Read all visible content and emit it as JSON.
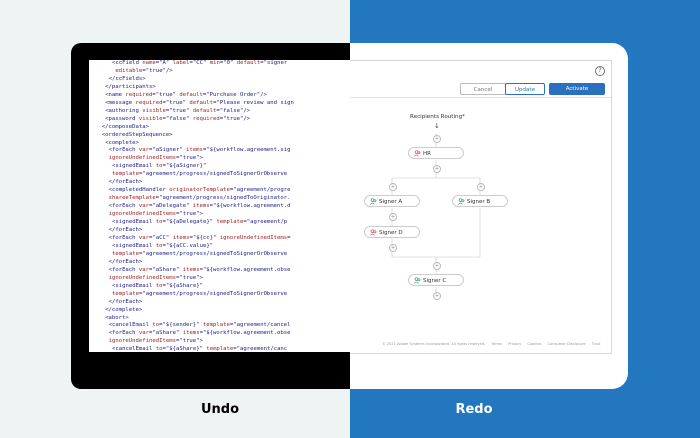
{
  "code_lines": [
    {
      "ind": 5,
      "toks": [
        [
          "t",
          "<ccField "
        ],
        [
          "a",
          "name"
        ],
        [
          "t",
          "="
        ],
        [
          "v",
          "\"A\""
        ],
        [
          "t",
          " "
        ],
        [
          "a",
          "label"
        ],
        [
          "t",
          "="
        ],
        [
          "v",
          "\"CC\""
        ],
        [
          "t",
          " "
        ],
        [
          "a",
          "min"
        ],
        [
          "t",
          "="
        ],
        [
          "v",
          "\"0\""
        ],
        [
          "t",
          " "
        ],
        [
          "a",
          "default"
        ],
        [
          "t",
          "="
        ],
        [
          "v",
          "\"signer"
        ]
      ]
    },
    {
      "ind": 6,
      "toks": [
        [
          "a",
          "editable"
        ],
        [
          "t",
          "="
        ],
        [
          "v",
          "\"true\""
        ],
        [
          "t",
          "/>"
        ]
      ]
    },
    {
      "ind": 4,
      "toks": [
        [
          "t",
          "</ccFields>"
        ]
      ]
    },
    {
      "ind": 3,
      "toks": [
        [
          "t",
          "</participants>"
        ]
      ]
    },
    {
      "ind": 3,
      "toks": [
        [
          "t",
          "<name "
        ],
        [
          "a",
          "required"
        ],
        [
          "t",
          "="
        ],
        [
          "v",
          "\"true\""
        ],
        [
          "t",
          " "
        ],
        [
          "a",
          "default"
        ],
        [
          "t",
          "="
        ],
        [
          "v",
          "\"Purchase Order\""
        ],
        [
          "t",
          "/>"
        ]
      ]
    },
    {
      "ind": 3,
      "toks": [
        [
          "t",
          "<message "
        ],
        [
          "a",
          "required"
        ],
        [
          "t",
          "="
        ],
        [
          "v",
          "\"true\""
        ],
        [
          "t",
          " "
        ],
        [
          "a",
          "default"
        ],
        [
          "t",
          "="
        ],
        [
          "v",
          "\"Please review and sign"
        ]
      ]
    },
    {
      "ind": 3,
      "toks": [
        [
          "t",
          "<authoring "
        ],
        [
          "a",
          "visible"
        ],
        [
          "t",
          "="
        ],
        [
          "v",
          "\"true\""
        ],
        [
          "t",
          " "
        ],
        [
          "a",
          "default"
        ],
        [
          "t",
          "="
        ],
        [
          "v",
          "\"false\""
        ],
        [
          "t",
          "/>"
        ]
      ]
    },
    {
      "ind": 3,
      "toks": [
        [
          "t",
          "<password "
        ],
        [
          "a",
          "visible"
        ],
        [
          "t",
          "="
        ],
        [
          "v",
          "\"false\""
        ],
        [
          "t",
          " "
        ],
        [
          "a",
          "required"
        ],
        [
          "t",
          "="
        ],
        [
          "v",
          "\"true\""
        ],
        [
          "t",
          "/>"
        ]
      ]
    },
    {
      "ind": 2,
      "toks": [
        [
          "t",
          "</composeData>"
        ]
      ]
    },
    {
      "ind": 2,
      "toks": [
        [
          "t",
          "<orderedStepSequence>"
        ]
      ]
    },
    {
      "ind": 3,
      "toks": [
        [
          "t",
          "<complete>"
        ]
      ]
    },
    {
      "ind": 4,
      "toks": [
        [
          "t",
          "<forEach "
        ],
        [
          "a",
          "var"
        ],
        [
          "t",
          "="
        ],
        [
          "v",
          "\"aSigner\""
        ],
        [
          "t",
          " "
        ],
        [
          "a",
          "items"
        ],
        [
          "t",
          "="
        ],
        [
          "v",
          "\"${workflow.agreement.sig"
        ]
      ]
    },
    {
      "ind": 4,
      "toks": [
        [
          "a",
          "ignoreUndefinedItems"
        ],
        [
          "t",
          "="
        ],
        [
          "v",
          "\"true\""
        ],
        [
          "t",
          ">"
        ]
      ]
    },
    {
      "ind": 5,
      "toks": [
        [
          "t",
          "<signedEmail "
        ],
        [
          "a",
          "to"
        ],
        [
          "t",
          "="
        ],
        [
          "v",
          "\"${aSigner}\""
        ]
      ]
    },
    {
      "ind": 5,
      "toks": [
        [
          "a",
          "template"
        ],
        [
          "t",
          "="
        ],
        [
          "v",
          "\"agreement/progress/signedToSignerOrObserve"
        ]
      ]
    },
    {
      "ind": 4,
      "toks": [
        [
          "t",
          "</forEach>"
        ]
      ]
    },
    {
      "ind": 4,
      "toks": [
        [
          "t",
          "<completedHandler "
        ],
        [
          "a",
          "originatorTemplate"
        ],
        [
          "t",
          "="
        ],
        [
          "v",
          "\"agreement/progre"
        ]
      ]
    },
    {
      "ind": 4,
      "toks": [
        [
          "a",
          "shareeTemplate"
        ],
        [
          "t",
          "="
        ],
        [
          "v",
          "\"agreement/progress/signedToOriginator."
        ]
      ]
    },
    {
      "ind": 4,
      "toks": [
        [
          "t",
          "<forEach "
        ],
        [
          "a",
          "var"
        ],
        [
          "t",
          "="
        ],
        [
          "v",
          "\"aDelegate\""
        ],
        [
          "t",
          " "
        ],
        [
          "a",
          "items"
        ],
        [
          "t",
          "="
        ],
        [
          "v",
          "\"${workflow.agreement.d"
        ]
      ]
    },
    {
      "ind": 4,
      "toks": [
        [
          "a",
          "ignoreUndefinedItems"
        ],
        [
          "t",
          "="
        ],
        [
          "v",
          "\"true\""
        ],
        [
          "t",
          ">"
        ]
      ]
    },
    {
      "ind": 5,
      "toks": [
        [
          "t",
          "<signedEmail "
        ],
        [
          "a",
          "to"
        ],
        [
          "t",
          "="
        ],
        [
          "v",
          "\"${aDelegate}\""
        ],
        [
          "t",
          " "
        ],
        [
          "a",
          "template"
        ],
        [
          "t",
          "="
        ],
        [
          "v",
          "\"agreement/p"
        ]
      ]
    },
    {
      "ind": 4,
      "toks": [
        [
          "t",
          "</forEach>"
        ]
      ]
    },
    {
      "ind": 4,
      "toks": [
        [
          "t",
          "<forEach "
        ],
        [
          "a",
          "var"
        ],
        [
          "t",
          "="
        ],
        [
          "v",
          "\"aCC\""
        ],
        [
          "t",
          " "
        ],
        [
          "a",
          "items"
        ],
        [
          "t",
          "="
        ],
        [
          "v",
          "\"${cc}\""
        ],
        [
          "t",
          " "
        ],
        [
          "a",
          "ignoreUndefinedItems"
        ],
        [
          "t",
          "="
        ]
      ]
    },
    {
      "ind": 5,
      "toks": [
        [
          "t",
          "<signedEmail "
        ],
        [
          "a",
          "to"
        ],
        [
          "t",
          "="
        ],
        [
          "v",
          "\"${aCC.value}\""
        ]
      ]
    },
    {
      "ind": 5,
      "toks": [
        [
          "a",
          "template"
        ],
        [
          "t",
          "="
        ],
        [
          "v",
          "\"agreement/progress/signedToSignerOrObserve"
        ]
      ]
    },
    {
      "ind": 4,
      "toks": [
        [
          "t",
          "</forEach>"
        ]
      ]
    },
    {
      "ind": 4,
      "toks": [
        [
          "t",
          "<forEach "
        ],
        [
          "a",
          "var"
        ],
        [
          "t",
          "="
        ],
        [
          "v",
          "\"aShare\""
        ],
        [
          "t",
          " "
        ],
        [
          "a",
          "items"
        ],
        [
          "t",
          "="
        ],
        [
          "v",
          "\"${workflow.agreement.obse"
        ]
      ]
    },
    {
      "ind": 4,
      "toks": [
        [
          "a",
          "ignoreUndefinedItems"
        ],
        [
          "t",
          "="
        ],
        [
          "v",
          "\"true\""
        ],
        [
          "t",
          ">"
        ]
      ]
    },
    {
      "ind": 5,
      "toks": [
        [
          "t",
          "<signedEmail "
        ],
        [
          "a",
          "to"
        ],
        [
          "t",
          "="
        ],
        [
          "v",
          "\"${aShare}\""
        ]
      ]
    },
    {
      "ind": 5,
      "toks": [
        [
          "a",
          "template"
        ],
        [
          "t",
          "="
        ],
        [
          "v",
          "\"agreement/progress/signedToSignerOrObserve"
        ]
      ]
    },
    {
      "ind": 4,
      "toks": [
        [
          "t",
          "</forEach>"
        ]
      ]
    },
    {
      "ind": 3,
      "toks": [
        [
          "t",
          "</complete>"
        ]
      ]
    },
    {
      "ind": 3,
      "toks": [
        [
          "t",
          "<abort>"
        ]
      ]
    },
    {
      "ind": 4,
      "toks": [
        [
          "t",
          "<cancelEmail "
        ],
        [
          "a",
          "to"
        ],
        [
          "t",
          "="
        ],
        [
          "v",
          "\"${sender}\""
        ],
        [
          "t",
          " "
        ],
        [
          "a",
          "template"
        ],
        [
          "t",
          "="
        ],
        [
          "v",
          "\"agreement/cancel"
        ]
      ]
    },
    {
      "ind": 4,
      "toks": [
        [
          "t",
          "<forEach "
        ],
        [
          "a",
          "var"
        ],
        [
          "t",
          "="
        ],
        [
          "v",
          "\"aShare\""
        ],
        [
          "t",
          " "
        ],
        [
          "a",
          "items"
        ],
        [
          "t",
          "="
        ],
        [
          "v",
          "\"${workflow.agreement.obse"
        ]
      ]
    },
    {
      "ind": 4,
      "toks": [
        [
          "a",
          "ignoreUndefinedItems"
        ],
        [
          "t",
          "="
        ],
        [
          "v",
          "\"true\""
        ],
        [
          "t",
          ">"
        ]
      ]
    },
    {
      "ind": 5,
      "toks": [
        [
          "t",
          "<cancelEmail "
        ],
        [
          "a",
          "to"
        ],
        [
          "t",
          "="
        ],
        [
          "v",
          "\"${aShare}\""
        ],
        [
          "t",
          " "
        ],
        [
          "a",
          "template"
        ],
        [
          "t",
          "="
        ],
        [
          "v",
          "\"agreement/canc"
        ]
      ]
    }
  ],
  "toolbar": {
    "help": "?",
    "cancel_label": "Cancel",
    "update_label": "Update",
    "activate_label": "Activate"
  },
  "workflow": {
    "routing_label": "Recipients Routing",
    "routing_required": "*",
    "arrow": "↓",
    "nodes": {
      "hr": "HR",
      "signer_a": "Signer A",
      "signer_b": "Signer B",
      "signer_d": "Signer D",
      "signer_c": "Signer C"
    }
  },
  "footer": {
    "copyright": "© 2021 Adobe Systems Incorporated. All rights reserved.",
    "links": [
      "Terms",
      "Privacy",
      "Cookies",
      "Consumer Disclosure",
      "Trust"
    ]
  },
  "labels": {
    "undo": "Undo",
    "redo": "Redo"
  },
  "colors": {
    "left_background": "#eef3f4",
    "right_background": "#2277be",
    "accent_blue": "#2b6fc0",
    "icon_pink": "#d8405a",
    "icon_green": "#2e9b73"
  }
}
